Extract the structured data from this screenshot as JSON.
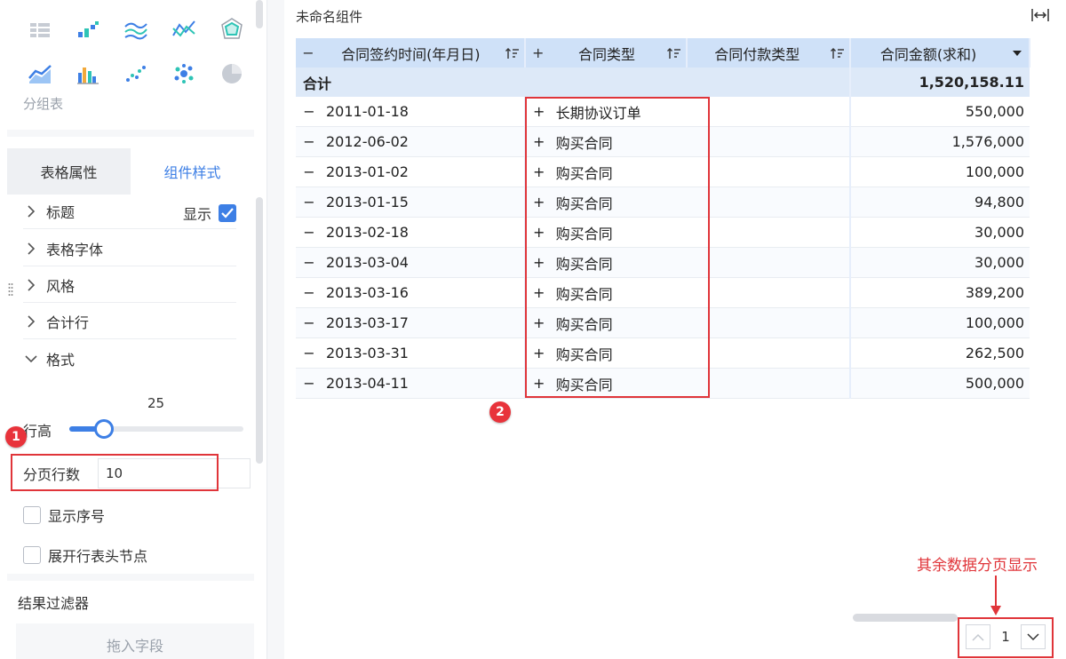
{
  "left_panel": {
    "chart_icons": [
      "table-group-icon",
      "bar-scatter-icon",
      "multi-line-icon",
      "line-scatter-icon",
      "radar-icon",
      "area-line-icon",
      "bar-cluster-icon",
      "dot-scatter-icon",
      "bubble-icon",
      "pie-icon"
    ],
    "selected_chart_label": "分组表",
    "tabs": [
      "表格属性",
      "组件样式"
    ],
    "active_tab": "组件样式",
    "accordion": {
      "title": "标题",
      "title_show_label": "显示",
      "font": "表格字体",
      "style": "风格",
      "total_row": "合计行",
      "format": "格式"
    },
    "row_height": {
      "label": "行高",
      "value": "25",
      "fraction": 0.2
    },
    "page_rows": {
      "label": "分页行数",
      "value": "10"
    },
    "checkbox_show_index": "显示序号",
    "checkbox_expand_header": "展开行表头节点",
    "result_filter": {
      "title": "结果过滤器",
      "drop_placeholder": "拖入字段"
    }
  },
  "widget": {
    "title": "未命名组件",
    "columns": [
      {
        "label": "合同签约时间(年月日)",
        "toggle": "−"
      },
      {
        "label": "合同类型",
        "toggle": "+"
      },
      {
        "label": "合同付款类型"
      },
      {
        "label": "合同金额(求和)"
      }
    ],
    "total": {
      "label": "合计",
      "amount": "1,520,158.11"
    },
    "rows": [
      {
        "date": "2011-01-18",
        "type": "长期协议订单",
        "amount": "550,000"
      },
      {
        "date": "2012-06-02",
        "type": "购买合同",
        "amount": "1,576,000"
      },
      {
        "date": "2013-01-02",
        "type": "购买合同",
        "amount": "100,000"
      },
      {
        "date": "2013-01-15",
        "type": "购买合同",
        "amount": "94,800"
      },
      {
        "date": "2013-02-18",
        "type": "购买合同",
        "amount": "30,000"
      },
      {
        "date": "2013-03-04",
        "type": "购买合同",
        "amount": "30,000"
      },
      {
        "date": "2013-03-16",
        "type": "购买合同",
        "amount": "389,200"
      },
      {
        "date": "2013-03-17",
        "type": "购买合同",
        "amount": "100,000"
      },
      {
        "date": "2013-03-31",
        "type": "购买合同",
        "amount": "262,500"
      },
      {
        "date": "2013-04-11",
        "type": "购买合同",
        "amount": "500,000"
      }
    ],
    "row_minus": "−",
    "row_plus": "+",
    "pager": {
      "current": "1"
    }
  },
  "annotations": {
    "badge1": "1",
    "badge2": "2",
    "remaining_pages_note": "其余数据分页显示"
  },
  "colors": {
    "accent": "#3d7fe5",
    "header_bg": "#cfe1f8",
    "highlight_red": "#e0353a"
  }
}
